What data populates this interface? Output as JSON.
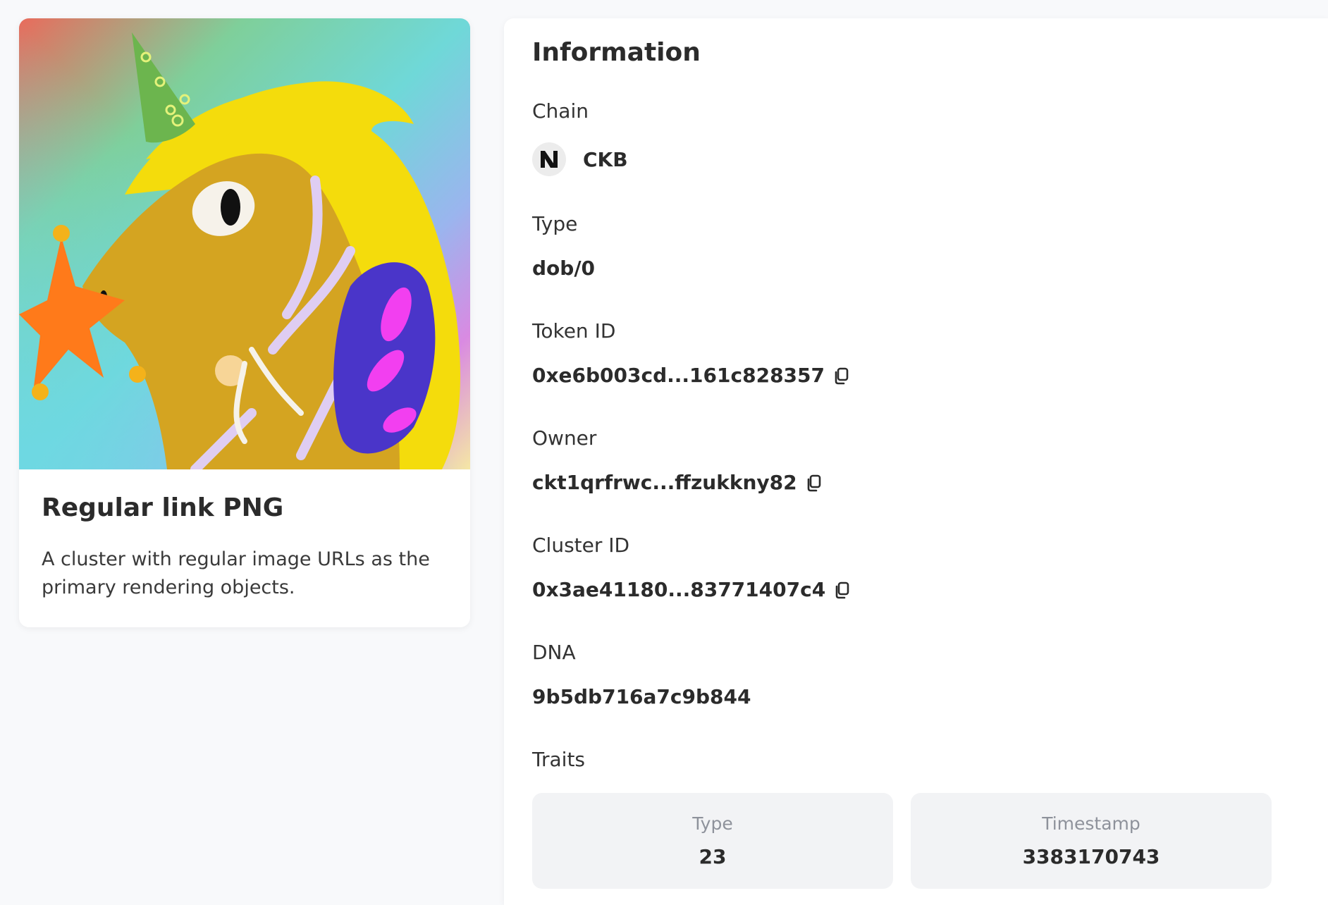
{
  "nft": {
    "title": "Regular link PNG",
    "description": "A cluster with regular image URLs as the primary rendering objects.",
    "image_alt": "unicorn-with-party-hat-illustration"
  },
  "info": {
    "heading": "Information",
    "chain": {
      "label": "Chain",
      "value": "CKB",
      "icon": "nervos-logo-icon"
    },
    "type": {
      "label": "Type",
      "value": "dob/0"
    },
    "token_id": {
      "label": "Token ID",
      "value": "0xe6b003cd...161c828357",
      "icon": "copy-icon"
    },
    "owner": {
      "label": "Owner",
      "value": "ckt1qrfrwc...ffzukkny82",
      "icon": "copy-icon"
    },
    "cluster_id": {
      "label": "Cluster ID",
      "value": "0x3ae41180...83771407c4",
      "icon": "copy-icon"
    },
    "dna": {
      "label": "DNA",
      "value": "9b5db716a7c9b844"
    },
    "traits": {
      "label": "Traits",
      "items": [
        {
          "name": "Type",
          "value": "23"
        },
        {
          "name": "Timestamp",
          "value": "3383170743"
        }
      ]
    }
  },
  "colors": {
    "page_background": "#f8f9fb",
    "card_background": "#ffffff",
    "trait_background": "#f2f3f5",
    "text_primary": "#2b2b2b",
    "text_muted": "#8e929b"
  }
}
